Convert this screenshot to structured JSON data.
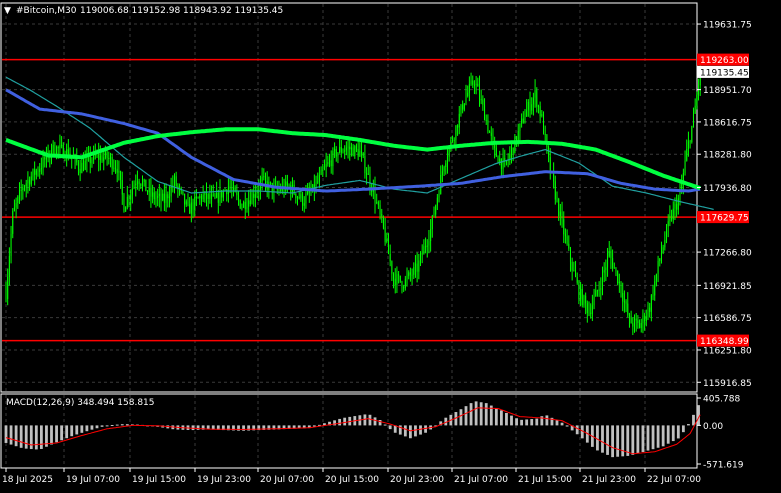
{
  "header": {
    "symbol_text": "#Bitcoin,M30",
    "ohlc_text": "119006.68 119152.98 118943.92 119135.45",
    "menu_glyph": "▼"
  },
  "macd": {
    "label": "MACD(12,26,9) 348.494 158.815",
    "ticks": [
      {
        "value": 405.788,
        "label": "405.788"
      },
      {
        "value": 0.0,
        "label": "0.00"
      },
      {
        "value": -571.619,
        "label": "-571.619"
      }
    ]
  },
  "colors": {
    "background": "#000000",
    "candle": "#00FF00",
    "grid": "#3A3A3A",
    "hline": "#FF0000",
    "hline_label_bg": "#FF0000",
    "ma_slow": "#00FF40",
    "ma_mid": "#4060E0",
    "ma_fast": "#20A0A0",
    "macd_hist": "#C0C0C0",
    "macd_signal": "#FF0000",
    "axis_text": "#FFFFFF"
  },
  "chart_data": {
    "type": "line",
    "title": "",
    "ylim": [
      115816.0,
      119850.0
    ],
    "y_ticks": [
      {
        "value": 119631.75,
        "label": "119631.75"
      },
      {
        "value": 118951.7,
        "label": "118951.70"
      },
      {
        "value": 118616.75,
        "label": "118616.75"
      },
      {
        "value": 118281.8,
        "label": "118281.80"
      },
      {
        "value": 117936.8,
        "label": "117936.80"
      },
      {
        "value": 117266.8,
        "label": "117266.80"
      },
      {
        "value": 116921.85,
        "label": "116921.85"
      },
      {
        "value": 116586.75,
        "label": "116586.75"
      },
      {
        "value": 116251.8,
        "label": "116251.80"
      },
      {
        "value": 115916.85,
        "label": "115916.85"
      }
    ],
    "x_labels": [
      "18 Jul 2025",
      "19 Jul 07:00",
      "19 Jul 15:00",
      "19 Jul 23:00",
      "20 Jul 07:00",
      "20 Jul 15:00",
      "20 Jul 23:00",
      "21 Jul 07:00",
      "21 Jul 15:00",
      "21 Jul 23:00",
      "22 Jul 07:00"
    ],
    "horizontal_levels": [
      {
        "value": 119263.0,
        "label": "119263.00"
      },
      {
        "value": 117629.75,
        "label": "117629.75"
      },
      {
        "value": 116348.99,
        "label": "116348.99"
      }
    ],
    "current_price": {
      "value": 119135.45,
      "label": "119135.45"
    },
    "close_anchors": [
      [
        0,
        116850
      ],
      [
        4,
        117650
      ],
      [
        10,
        117950
      ],
      [
        20,
        118150
      ],
      [
        28,
        118350
      ],
      [
        36,
        118300
      ],
      [
        44,
        118150
      ],
      [
        52,
        118250
      ],
      [
        60,
        118250
      ],
      [
        66,
        118150
      ],
      [
        70,
        117750
      ],
      [
        78,
        118050
      ],
      [
        86,
        117850
      ],
      [
        94,
        117800
      ],
      [
        100,
        118000
      ],
      [
        108,
        117700
      ],
      [
        116,
        117850
      ],
      [
        124,
        117800
      ],
      [
        132,
        117950
      ],
      [
        140,
        117750
      ],
      [
        146,
        117850
      ],
      [
        152,
        118000
      ],
      [
        160,
        117900
      ],
      [
        168,
        117950
      ],
      [
        176,
        117800
      ],
      [
        182,
        117900
      ],
      [
        190,
        118150
      ],
      [
        196,
        118300
      ],
      [
        202,
        118350
      ],
      [
        210,
        118300
      ],
      [
        218,
        117900
      ],
      [
        224,
        117500
      ],
      [
        230,
        117000
      ],
      [
        236,
        116950
      ],
      [
        244,
        117100
      ],
      [
        252,
        117500
      ],
      [
        260,
        118200
      ],
      [
        266,
        118500
      ],
      [
        272,
        118850
      ],
      [
        278,
        119050
      ],
      [
        284,
        118700
      ],
      [
        290,
        118300
      ],
      [
        296,
        118150
      ],
      [
        302,
        118400
      ],
      [
        308,
        118700
      ],
      [
        314,
        118900
      ],
      [
        318,
        118650
      ],
      [
        322,
        118200
      ],
      [
        328,
        117700
      ],
      [
        334,
        117250
      ],
      [
        340,
        116850
      ],
      [
        346,
        116650
      ],
      [
        352,
        116900
      ],
      [
        358,
        117250
      ],
      [
        364,
        116950
      ],
      [
        370,
        116550
      ],
      [
        376,
        116500
      ],
      [
        382,
        116700
      ],
      [
        388,
        117200
      ],
      [
        394,
        117600
      ],
      [
        400,
        117850
      ],
      [
        404,
        118300
      ],
      [
        408,
        118650
      ],
      [
        412,
        119135
      ]
    ],
    "series": [
      {
        "values": [
          [
            0,
            119080
          ],
          [
            14,
            118950
          ],
          [
            30,
            118780
          ],
          [
            50,
            118550
          ],
          [
            70,
            118250
          ],
          [
            90,
            118000
          ],
          [
            110,
            117880
          ],
          [
            130,
            117900
          ],
          [
            150,
            117900
          ],
          [
            170,
            117880
          ],
          [
            190,
            117960
          ],
          [
            210,
            118010
          ],
          [
            230,
            117920
          ],
          [
            250,
            117880
          ],
          [
            270,
            118030
          ],
          [
            290,
            118180
          ],
          [
            305,
            118260
          ],
          [
            320,
            118330
          ],
          [
            340,
            118190
          ],
          [
            360,
            117950
          ],
          [
            380,
            117880
          ],
          [
            400,
            117790
          ],
          [
            420,
            117710
          ]
        ]
      },
      {
        "values": [
          [
            0,
            118950
          ],
          [
            20,
            118750
          ],
          [
            45,
            118700
          ],
          [
            70,
            118600
          ],
          [
            90,
            118500
          ],
          [
            110,
            118250
          ],
          [
            135,
            118020
          ],
          [
            160,
            117940
          ],
          [
            190,
            117900
          ],
          [
            215,
            117920
          ],
          [
            245,
            117950
          ],
          [
            270,
            117980
          ],
          [
            295,
            118050
          ],
          [
            320,
            118100
          ],
          [
            345,
            118080
          ],
          [
            365,
            117980
          ],
          [
            385,
            117920
          ],
          [
            405,
            117900
          ],
          [
            412,
            117920
          ]
        ]
      },
      {
        "values": [
          [
            0,
            118430
          ],
          [
            25,
            118270
          ],
          [
            45,
            118250
          ],
          [
            70,
            118400
          ],
          [
            90,
            118470
          ],
          [
            110,
            118510
          ],
          [
            130,
            118540
          ],
          [
            150,
            118540
          ],
          [
            170,
            118500
          ],
          [
            190,
            118480
          ],
          [
            210,
            118430
          ],
          [
            230,
            118370
          ],
          [
            250,
            118330
          ],
          [
            270,
            118370
          ],
          [
            290,
            118400
          ],
          [
            310,
            118410
          ],
          [
            330,
            118390
          ],
          [
            350,
            118330
          ],
          [
            370,
            118200
          ],
          [
            390,
            118060
          ],
          [
            412,
            117930
          ]
        ]
      }
    ],
    "macd_histogram_anchors": [
      [
        0,
        -260
      ],
      [
        10,
        -340
      ],
      [
        20,
        -360
      ],
      [
        30,
        -250
      ],
      [
        40,
        -150
      ],
      [
        50,
        -70
      ],
      [
        60,
        0
      ],
      [
        70,
        20
      ],
      [
        80,
        10
      ],
      [
        90,
        -20
      ],
      [
        100,
        -60
      ],
      [
        110,
        -70
      ],
      [
        120,
        -60
      ],
      [
        130,
        -70
      ],
      [
        140,
        -80
      ],
      [
        150,
        -70
      ],
      [
        160,
        -60
      ],
      [
        170,
        -50
      ],
      [
        180,
        -40
      ],
      [
        190,
        40
      ],
      [
        200,
        110
      ],
      [
        210,
        150
      ],
      [
        215,
        170
      ],
      [
        222,
        80
      ],
      [
        230,
        -100
      ],
      [
        240,
        -190
      ],
      [
        250,
        -100
      ],
      [
        260,
        100
      ],
      [
        270,
        240
      ],
      [
        278,
        360
      ],
      [
        285,
        330
      ],
      [
        295,
        210
      ],
      [
        305,
        80
      ],
      [
        315,
        100
      ],
      [
        320,
        160
      ],
      [
        330,
        40
      ],
      [
        340,
        -150
      ],
      [
        350,
        -360
      ],
      [
        360,
        -470
      ],
      [
        370,
        -450
      ],
      [
        380,
        -380
      ],
      [
        390,
        -310
      ],
      [
        400,
        -180
      ],
      [
        406,
        60
      ],
      [
        412,
        348
      ]
    ],
    "macd_signal_anchors": [
      [
        0,
        -180
      ],
      [
        15,
        -290
      ],
      [
        30,
        -260
      ],
      [
        45,
        -150
      ],
      [
        60,
        -50
      ],
      [
        75,
        0
      ],
      [
        90,
        -5
      ],
      [
        105,
        -35
      ],
      [
        120,
        -55
      ],
      [
        140,
        -60
      ],
      [
        160,
        -50
      ],
      [
        180,
        -35
      ],
      [
        200,
        40
      ],
      [
        215,
        100
      ],
      [
        228,
        20
      ],
      [
        240,
        -80
      ],
      [
        255,
        -20
      ],
      [
        268,
        120
      ],
      [
        280,
        260
      ],
      [
        292,
        250
      ],
      [
        305,
        130
      ],
      [
        318,
        110
      ],
      [
        330,
        70
      ],
      [
        345,
        -120
      ],
      [
        360,
        -330
      ],
      [
        372,
        -420
      ],
      [
        385,
        -390
      ],
      [
        398,
        -280
      ],
      [
        406,
        -120
      ],
      [
        412,
        159
      ]
    ]
  }
}
